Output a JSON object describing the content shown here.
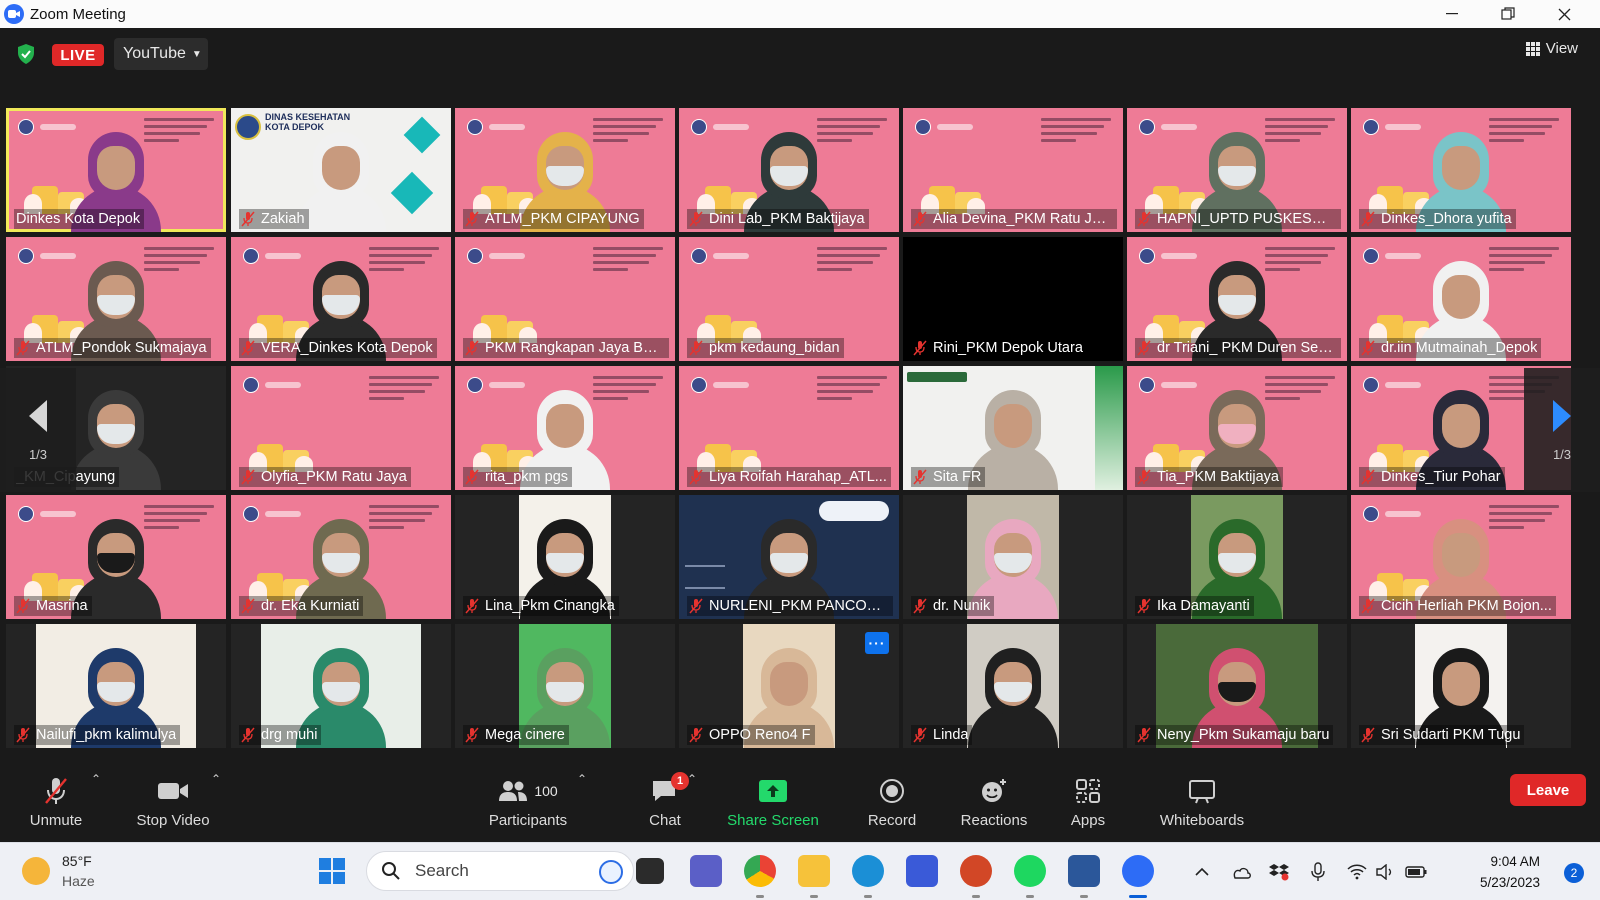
{
  "window": {
    "title": "Zoom Meeting"
  },
  "topbar": {
    "live_label": "LIVE",
    "stream_target": "YouTube",
    "view_label": "View"
  },
  "gallery": {
    "page_indicator_left": "1/3",
    "page_indicator_right": "1/3",
    "tiles": [
      {
        "name": "Dinkes Kota Depok",
        "muted": false,
        "active": true
      },
      {
        "name": "Zakiah",
        "muted": true
      },
      {
        "name": "ATLM_PKM CIPAYUNG",
        "muted": true
      },
      {
        "name": "Dini Lab_PKM Baktijaya",
        "muted": true
      },
      {
        "name": "Alia Devina_PKM Ratu Jaya",
        "muted": true
      },
      {
        "name": "HAPNI_UPTD PUSKESMA...",
        "muted": true
      },
      {
        "name": "Dinkes_Dhora yufita",
        "muted": true
      },
      {
        "name": "ATLM_Pondok Sukmajaya",
        "muted": true
      },
      {
        "name": "VERA_Dinkes Kota Depok",
        "muted": true
      },
      {
        "name": "PKM Rangkapan Jaya Bar...",
        "muted": true
      },
      {
        "name": "pkm kedaung_bidan",
        "muted": true
      },
      {
        "name": "Rini_PKM Depok Utara",
        "muted": true
      },
      {
        "name": "dr Triani_ PKM Duren Seri...",
        "muted": true
      },
      {
        "name": "dr.iin Mutmainah_Depok",
        "muted": true
      },
      {
        "name": "_KM_Cipayung",
        "muted": false
      },
      {
        "name": "Olyfia_PKM Ratu Jaya",
        "muted": true
      },
      {
        "name": "rita_pkm pgs",
        "muted": true
      },
      {
        "name": "Liya Roifah Harahap_ATL...",
        "muted": true
      },
      {
        "name": "Sita FR",
        "muted": true
      },
      {
        "name": "Tia_PKM Baktijaya",
        "muted": true
      },
      {
        "name": "Dinkes_Tiur Pohar",
        "muted": true
      },
      {
        "name": "Masrina",
        "muted": true
      },
      {
        "name": "dr. Eka Kurniati",
        "muted": true
      },
      {
        "name": "Lina_Pkm Cinangka",
        "muted": true
      },
      {
        "name": "NURLENI_PKM PANCORA...",
        "muted": true
      },
      {
        "name": "dr. Nunik",
        "muted": true
      },
      {
        "name": "Ika Damayanti",
        "muted": true
      },
      {
        "name": "Cicih Herliah PKM Bojon...",
        "muted": true
      },
      {
        "name": "Nailufi_pkm kalimulya",
        "muted": true
      },
      {
        "name": "drg muhi",
        "muted": true
      },
      {
        "name": "Mega cinere",
        "muted": true
      },
      {
        "name": "OPPO Reno4 F",
        "muted": true
      },
      {
        "name": "Linda",
        "muted": true
      },
      {
        "name": "Neny_Pkm Sukamaju baru",
        "muted": true
      },
      {
        "name": "Sri Sudarti PKM  Tugu",
        "muted": true
      }
    ],
    "zakiah_slide_title": "DINAS KESEHATAN KOTA DEPOK",
    "more_options": "···"
  },
  "toolbar": {
    "unmute": "Unmute",
    "stop_video": "Stop Video",
    "participants": "Participants",
    "participants_count": "100",
    "chat": "Chat",
    "chat_badge": "1",
    "share_screen": "Share Screen",
    "record": "Record",
    "reactions": "Reactions",
    "apps": "Apps",
    "whiteboards": "Whiteboards",
    "leave": "Leave"
  },
  "taskbar": {
    "temperature": "85°F",
    "condition": "Haze",
    "search_placeholder": "Search",
    "time": "9:04 AM",
    "date": "5/23/2023",
    "notifications": "2"
  },
  "colors": {
    "slide_pink": "#ee7b96",
    "active_border": "#f1e95a",
    "live_red": "#e02828",
    "share_green": "#23d96b",
    "zoom_blue": "#0e72ed"
  }
}
